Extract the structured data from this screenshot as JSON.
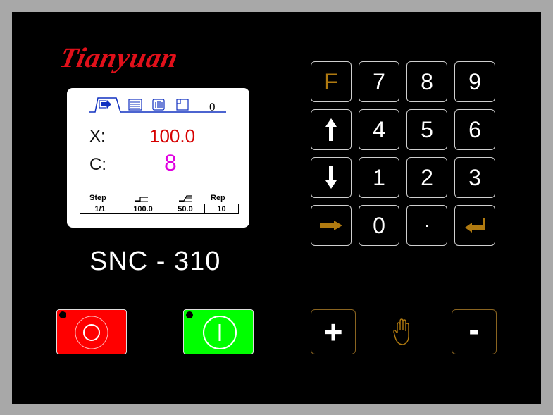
{
  "brand": "Tianyuan",
  "model": "SNC - 310",
  "screen": {
    "tab_value": "0",
    "x_label": "X:",
    "x_value": "100.0",
    "c_label": "C:",
    "c_value": "8",
    "table": {
      "headers": [
        "Step",
        "",
        "",
        "Rep"
      ],
      "values": [
        "1/1",
        "100.0",
        "50.0",
        "10"
      ]
    }
  },
  "keypad": {
    "rows": [
      [
        "F",
        "7",
        "8",
        "9"
      ],
      [
        "",
        "4",
        "5",
        "6"
      ],
      [
        "",
        "1",
        "2",
        "3"
      ],
      [
        "",
        "0",
        "·",
        ""
      ]
    ],
    "icons": [
      "up-arrow-icon",
      "down-arrow-icon",
      "right-arrow-icon",
      "enter-icon"
    ]
  },
  "colors": {
    "stop": "#ff0000",
    "start": "#00ff00",
    "brand": "#e0101a",
    "accent": "#b07a10",
    "x_value": "#d60000",
    "c_value": "#e000e0"
  },
  "controls": {
    "stop_symbol": "O",
    "start_symbol": "I",
    "plus": "+",
    "minus": "-"
  }
}
